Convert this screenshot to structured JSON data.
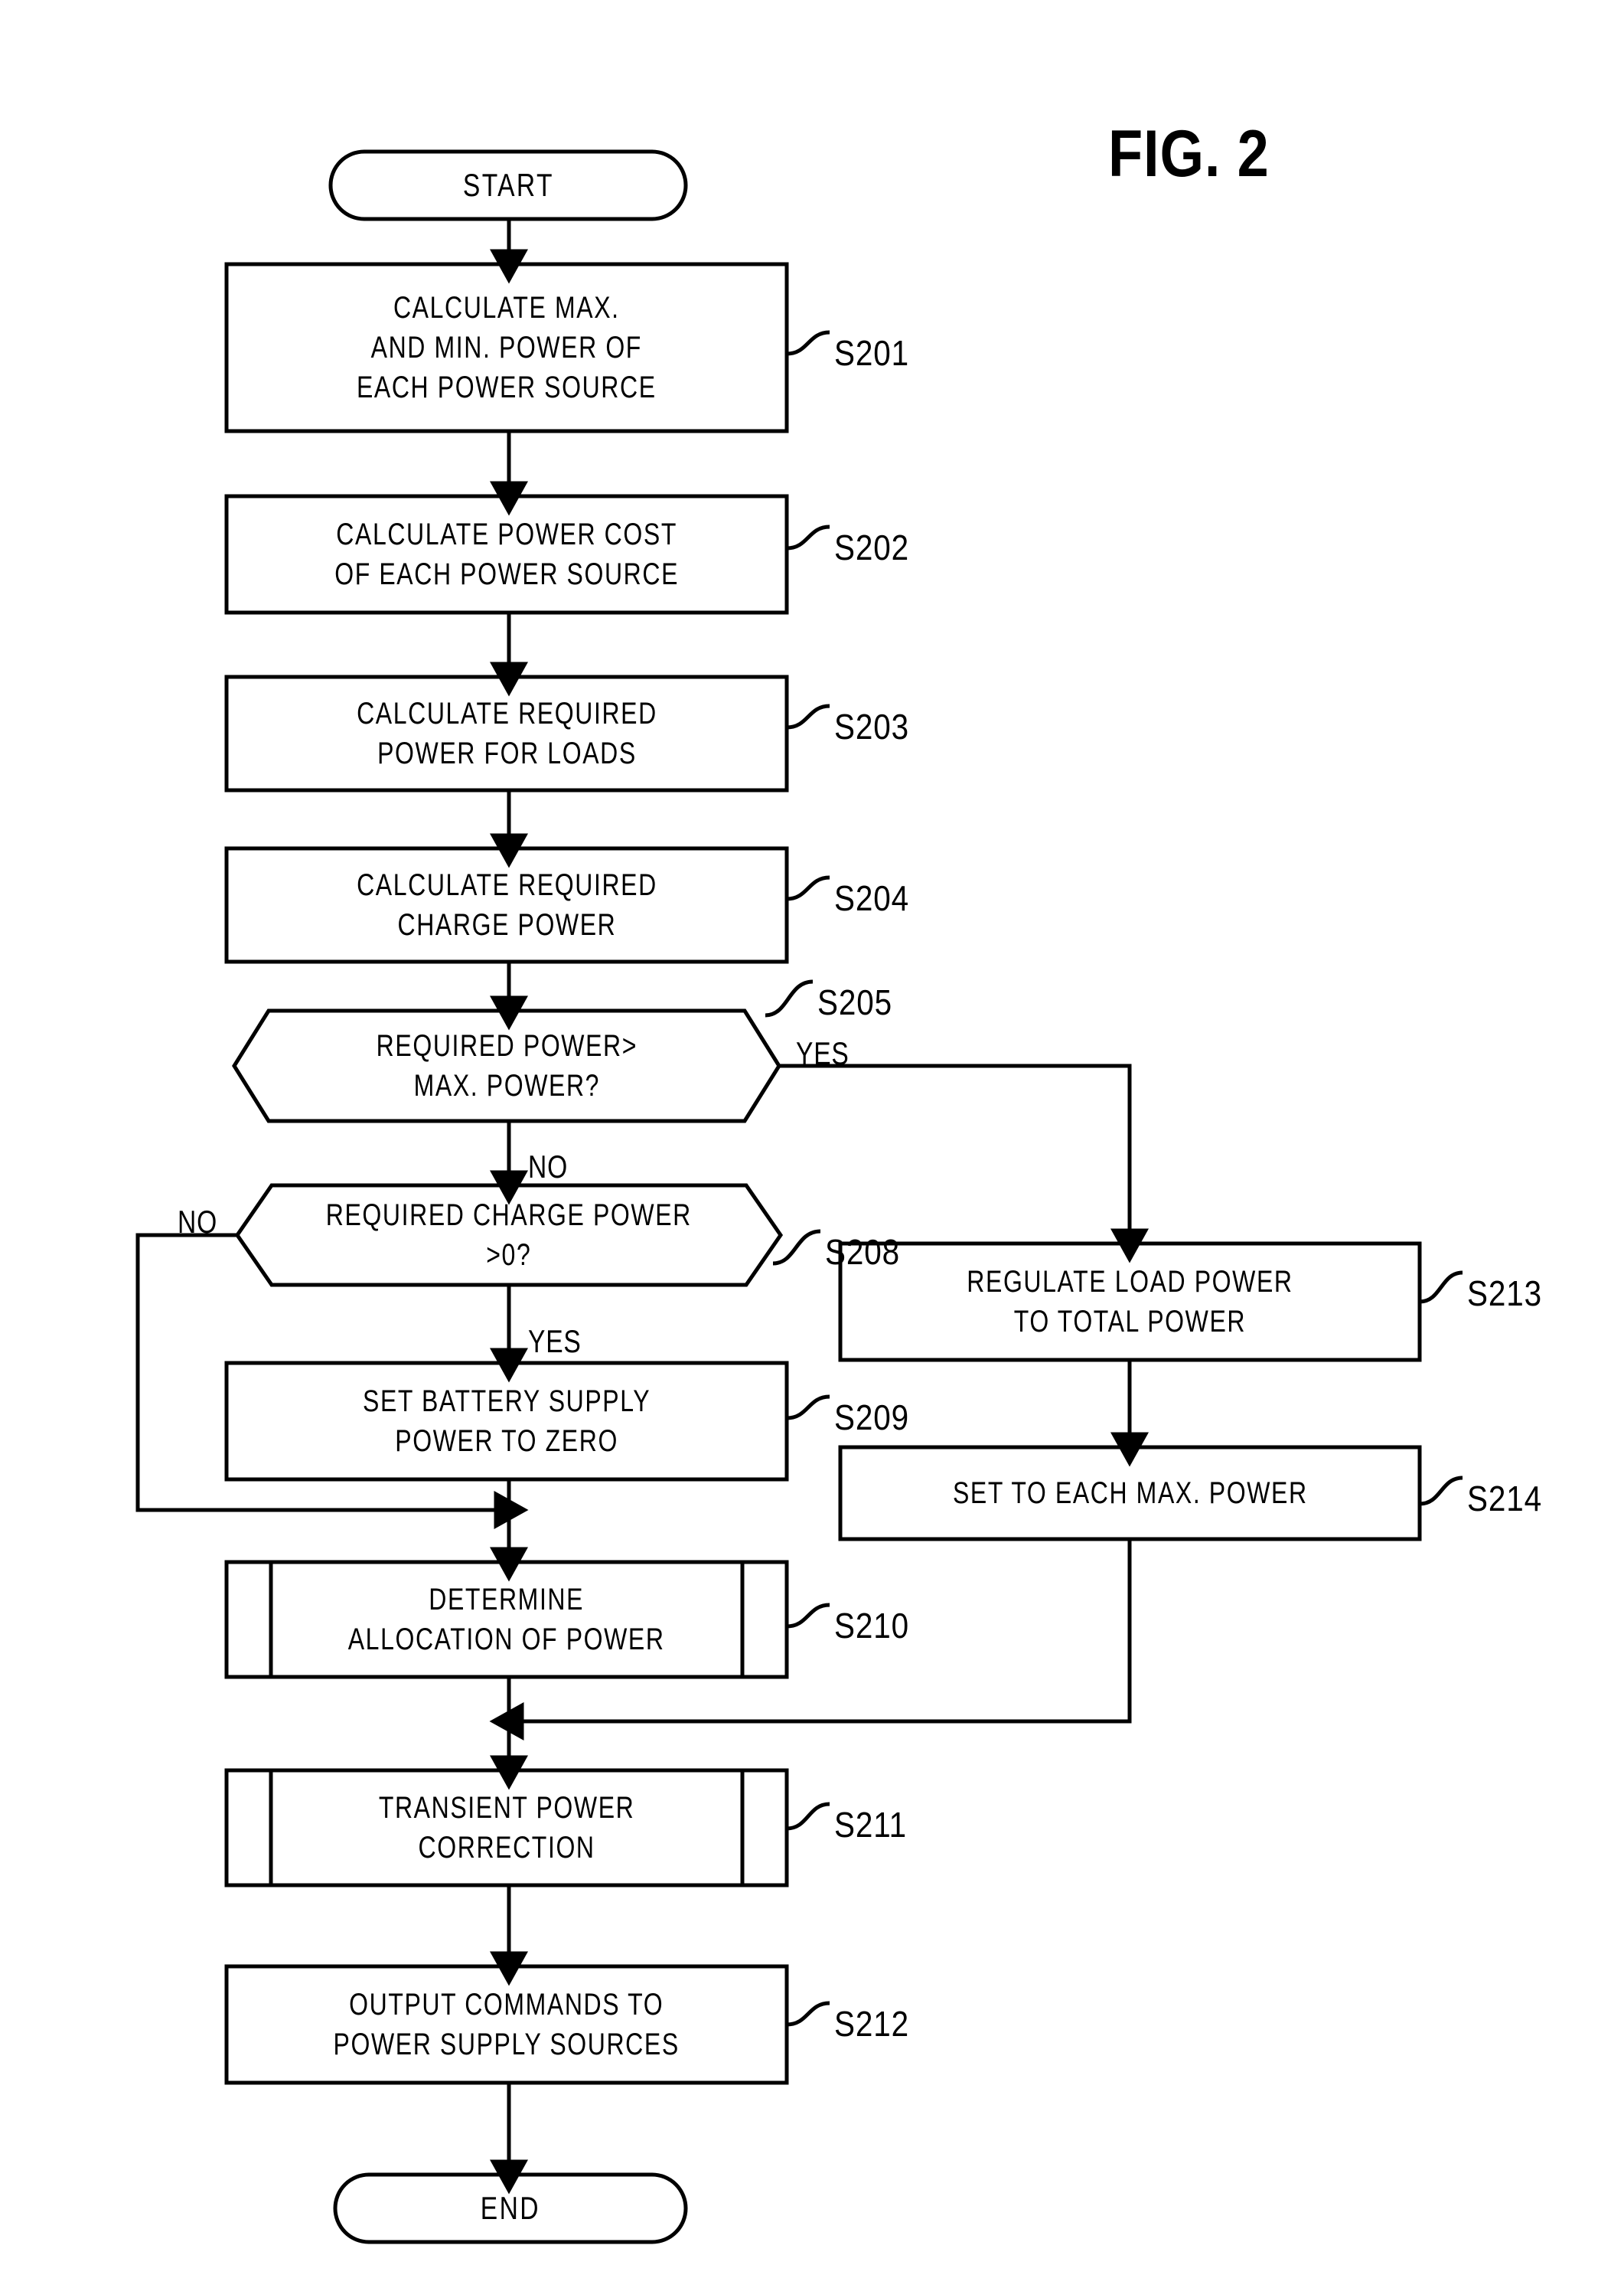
{
  "figure": {
    "title": "FIG. 2",
    "kind": "flowchart"
  },
  "terminators": {
    "start": "START",
    "end": "END"
  },
  "nodes": [
    {
      "id": "start",
      "shape": "terminator",
      "label": "START",
      "step": ""
    },
    {
      "id": "s201",
      "shape": "process",
      "label": "CALCULATE MAX.\nAND MIN. POWER OF\nEACH POWER SOURCE",
      "step": "S201"
    },
    {
      "id": "s202",
      "shape": "process",
      "label": "CALCULATE POWER COST\nOF EACH POWER SOURCE",
      "step": "S202"
    },
    {
      "id": "s203",
      "shape": "process",
      "label": "CALCULATE REQUIRED\nPOWER FOR LOADS",
      "step": "S203"
    },
    {
      "id": "s204",
      "shape": "process",
      "label": "CALCULATE REQUIRED\nCHARGE POWER",
      "step": "S204"
    },
    {
      "id": "s205",
      "shape": "decision",
      "label": "REQUIRED POWER>\nMAX. POWER?",
      "step": "S205"
    },
    {
      "id": "s208",
      "shape": "decision",
      "label": "REQUIRED CHARGE POWER\n>0?",
      "step": "S208"
    },
    {
      "id": "s209",
      "shape": "process",
      "label": "SET BATTERY SUPPLY\nPOWER TO ZERO",
      "step": "S209"
    },
    {
      "id": "s210",
      "shape": "predefined-process",
      "label": "DETERMINE\nALLOCATION OF POWER",
      "step": "S210"
    },
    {
      "id": "s211",
      "shape": "predefined-process",
      "label": "TRANSIENT POWER\nCORRECTION",
      "step": "S211"
    },
    {
      "id": "s212",
      "shape": "process",
      "label": "OUTPUT COMMANDS TO\nPOWER SUPPLY SOURCES",
      "step": "S212"
    },
    {
      "id": "s213",
      "shape": "process",
      "label": "REGULATE LOAD POWER\nTO TOTAL POWER",
      "step": "S213"
    },
    {
      "id": "s214",
      "shape": "process",
      "label": "SET TO EACH MAX. POWER",
      "step": "S214"
    },
    {
      "id": "end",
      "shape": "terminator",
      "label": "END",
      "step": ""
    }
  ],
  "edge_labels": {
    "s205_yes": "YES",
    "s205_no": "NO",
    "s208_no": "NO",
    "s208_yes": "YES"
  },
  "step_labels": {
    "s201": "S201",
    "s202": "S202",
    "s203": "S203",
    "s204": "S204",
    "s205": "S205",
    "s208": "S208",
    "s209": "S209",
    "s210": "S210",
    "s211": "S211",
    "s212": "S212",
    "s213": "S213",
    "s214": "S214"
  },
  "colors": {
    "stroke": "#000000",
    "background": "#ffffff"
  }
}
